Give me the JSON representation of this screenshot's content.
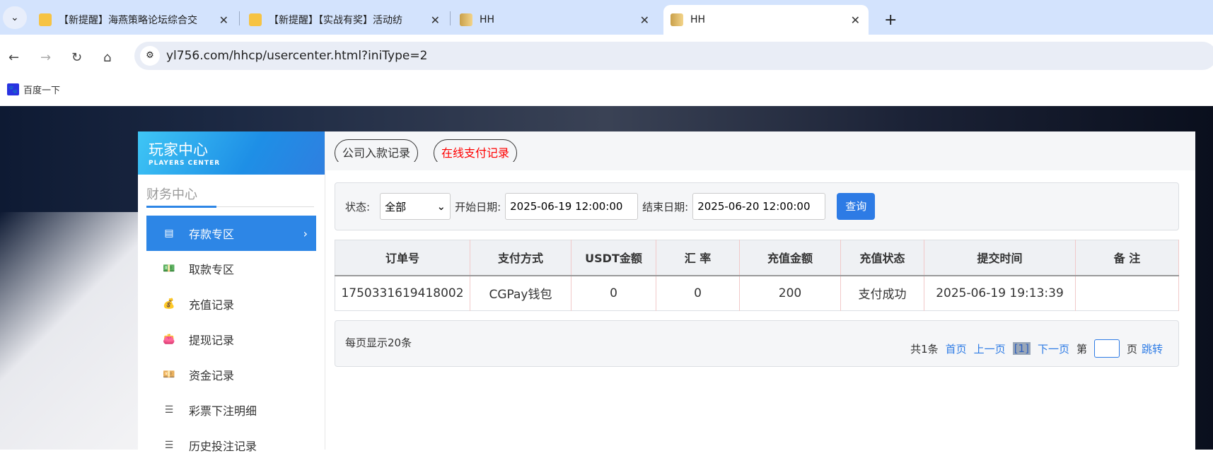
{
  "browser": {
    "tabs": [
      {
        "title": "【新提醒】海燕策略论坛综合交",
        "icon": "note-icon"
      },
      {
        "title": "【新提醒】【实战有奖】活动纺",
        "icon": "note-icon"
      },
      {
        "title": "HH",
        "icon": "hh-favicon"
      },
      {
        "title": "HH",
        "icon": "hh-favicon",
        "active": true
      }
    ],
    "url": "yl756.com/hhcp/usercenter.html?iniType=2",
    "bookmark": "百度一下"
  },
  "sidebar": {
    "logo_title": "玩家中心",
    "logo_sub": "PLAYERS CENTER",
    "section": "财务中心",
    "items": [
      {
        "label": "存款专区",
        "active": true
      },
      {
        "label": "取款专区"
      },
      {
        "label": "充值记录"
      },
      {
        "label": "提现记录"
      },
      {
        "label": "资金记录"
      },
      {
        "label": "彩票下注明细"
      },
      {
        "label": "历史投注记录"
      }
    ]
  },
  "main": {
    "tabs": [
      "公司入款记录",
      "在线支付记录"
    ],
    "filter": {
      "status_label": "状态:",
      "status_value": "全部",
      "start_label": "开始日期:",
      "start_value": "2025-06-19 12:00:00",
      "end_label": "结束日期:",
      "end_value": "2025-06-20 12:00:00",
      "query": "查询"
    },
    "table": {
      "headers": [
        "订单号",
        "支付方式",
        "USDT金额",
        "汇 率",
        "充值金额",
        "充值状态",
        "提交时间",
        "备 注"
      ],
      "rows": [
        [
          "1750331619418002",
          "CGPay钱包",
          "0",
          "0",
          "200",
          "支付成功",
          "2025-06-19 19:13:39",
          ""
        ]
      ]
    },
    "pager": {
      "per_page": "每页显示20条",
      "total": "共1条",
      "first": "首页",
      "prev": "上一页",
      "current": "[1]",
      "next": "下一页",
      "goto_pre": "第",
      "goto_post": "页",
      "jump": "跳转"
    }
  },
  "colors": {
    "accent": "#2d86e6",
    "active_tab_text": "#ff0000"
  }
}
